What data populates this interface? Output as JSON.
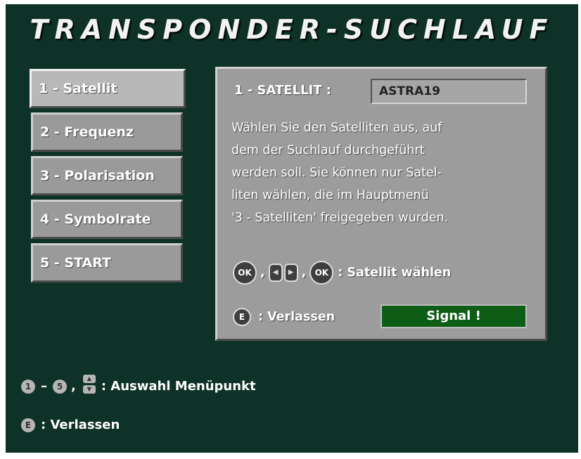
{
  "title": "TRANSPONDER-SUCHLAUF",
  "menu": {
    "items": [
      {
        "label": "1 - Satellit"
      },
      {
        "label": "2 - Frequenz"
      },
      {
        "label": "3 - Polarisation"
      },
      {
        "label": "4 - Symbolrate"
      },
      {
        "label": "5 - START"
      }
    ],
    "active_index": 0
  },
  "panel": {
    "satellite_label": "1 - SATELLIT :",
    "satellite_value": "ASTRA19",
    "description_lines": [
      "Wählen Sie den Satelliten aus, auf",
      "dem der Suchlauf durchgeführt",
      "werden soll. Sie können nur Satel-",
      "liten wählen, die im Hauptmenü",
      "'3 - Satelliten' freigegeben wurden."
    ],
    "help": {
      "ok_key": "OK",
      "sep1": ",",
      "left_key": "◀",
      "right_key": "▶",
      "sep2": ",",
      "ok_key2": "OK",
      "text": ": Satellit wählen"
    },
    "exit_key": "E",
    "exit_text": ": Verlassen",
    "signal_text": "Signal !"
  },
  "footer": {
    "key_from": "1",
    "dash": "–",
    "key_to": "5",
    "comma": ",",
    "up_key": "▲",
    "down_key": "▼",
    "select_text": ": Auswahl Menüpunkt",
    "exit_key": "E",
    "exit_text": ": Verlassen"
  },
  "colors": {
    "background": "#0e3227",
    "button": "#9a9a9a",
    "panel": "#9c9c9c",
    "signal": "#0d5d17"
  }
}
